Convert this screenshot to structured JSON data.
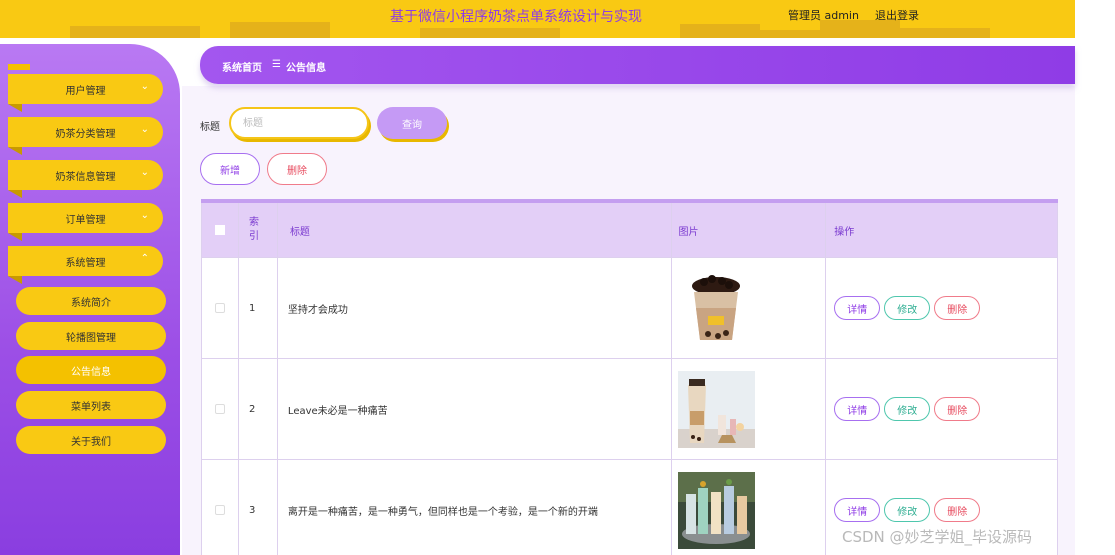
{
  "header": {
    "title": "基于微信小程序奶茶点单系统设计与实现",
    "admin": "管理员 admin",
    "logout": "退出登录"
  },
  "sidebar": {
    "menus": [
      {
        "label": "用户管理",
        "arrow": "⌄"
      },
      {
        "label": "奶茶分类管理",
        "arrow": "⌄"
      },
      {
        "label": "奶茶信息管理",
        "arrow": "⌄"
      },
      {
        "label": "订单管理",
        "arrow": "⌄"
      },
      {
        "label": "系统管理",
        "arrow": "⌃"
      }
    ],
    "submenu": [
      "系统简介",
      "轮播图管理",
      "公告信息",
      "菜单列表",
      "关于我们"
    ]
  },
  "breadcrumb": {
    "home": "系统首页",
    "separator": "☰",
    "current": "公告信息"
  },
  "search": {
    "label": "标题",
    "placeholder": "标题",
    "button": "查询"
  },
  "actions": {
    "add": "新增",
    "delete": "删除"
  },
  "table": {
    "headers": {
      "index": "索引",
      "title": "标题",
      "image": "图片",
      "ops": "操作"
    },
    "rows": [
      {
        "index": "1",
        "title": "坚持才会成功"
      },
      {
        "index": "2",
        "title": "Leave未必是一种痛苦"
      },
      {
        "index": "3",
        "title": "离开是一种痛苦，是一种勇气，但同样也是一个考验，是一个新的开端"
      }
    ],
    "ops": {
      "detail": "详情",
      "edit": "修改",
      "remove": "删除"
    }
  },
  "watermark": "CSDN @妙芝学姐_毕设源码",
  "colors": {
    "accent": "#8f3ce6",
    "yellow": "#f9c913",
    "danger": "#e74a5e",
    "teal": "#2fae92"
  }
}
